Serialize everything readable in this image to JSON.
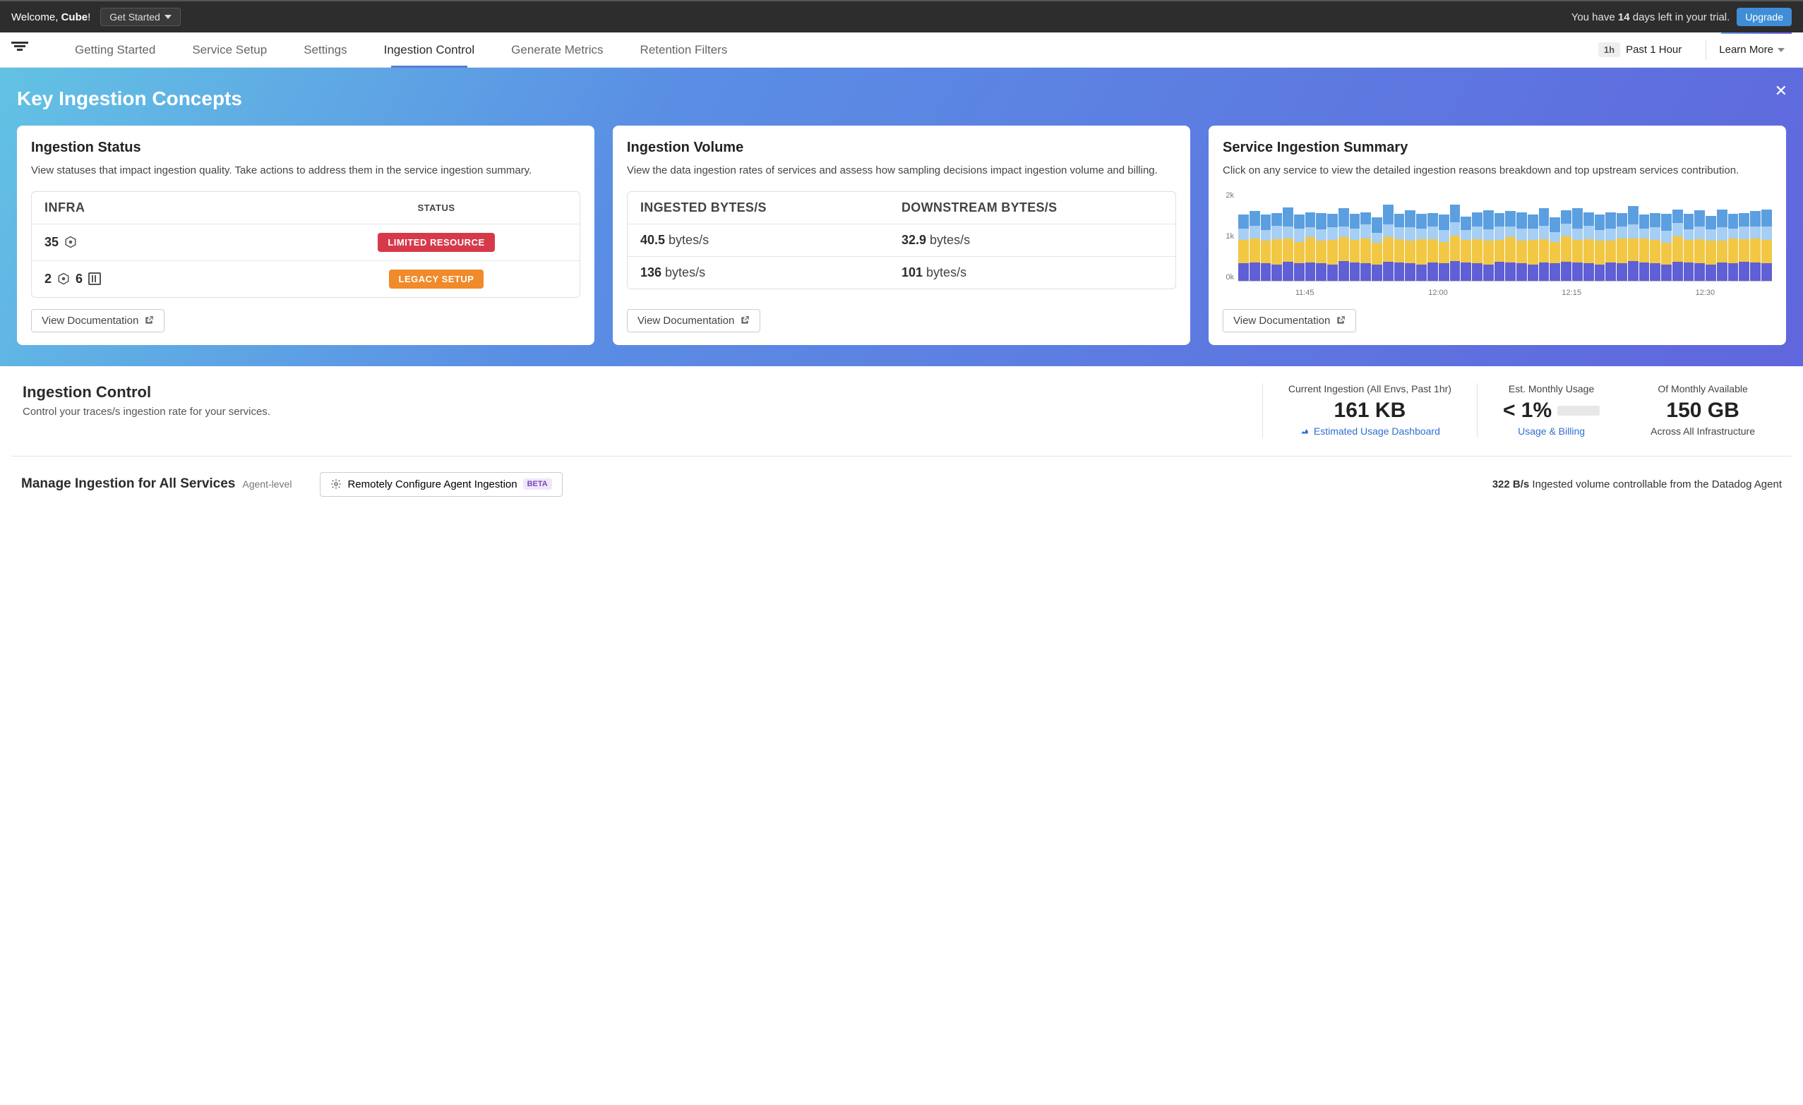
{
  "topbar": {
    "welcome_prefix": "Welcome, ",
    "welcome_name": "Cube",
    "welcome_suffix": "!",
    "get_started": "Get Started",
    "trial_prefix": "You have ",
    "trial_days": "14",
    "trial_suffix": " days left in your trial.",
    "upgrade": "Upgrade"
  },
  "nav": {
    "tabs": [
      "Getting Started",
      "Service Setup",
      "Settings",
      "Ingestion Control",
      "Generate Metrics",
      "Retention Filters"
    ],
    "active_index": 3,
    "time_pill": "1h",
    "time_label": "Past 1 Hour",
    "learn_more": "Learn More"
  },
  "hero": {
    "title": "Key Ingestion Concepts",
    "cards": [
      {
        "title": "Ingestion Status",
        "desc": "View statuses that impact ingestion quality. Take actions to address them in the service ingestion summary.",
        "headers": [
          "INFRA",
          "STATUS"
        ],
        "rows": [
          {
            "col1_a": "35",
            "icon1": "hex",
            "badge": "LIMITED RESOURCE",
            "badge_color": "red"
          },
          {
            "col1_a": "2",
            "icon1": "hex",
            "col1_b": "6",
            "icon2": "bars",
            "badge": "LEGACY SETUP",
            "badge_color": "orange"
          }
        ],
        "doc_label": "View Documentation"
      },
      {
        "title": "Ingestion Volume",
        "desc": "View the data ingestion rates of services and assess how sampling decisions impact ingestion volume and billing.",
        "headers": [
          "INGESTED BYTES/S",
          "DOWNSTREAM BYTES/S"
        ],
        "rows": [
          {
            "c1_val": "40.5",
            "c1_unit": " bytes/s",
            "c2_val": "32.9",
            "c2_unit": " bytes/s"
          },
          {
            "c1_val": "136",
            "c1_unit": " bytes/s",
            "c2_val": "101",
            "c2_unit": " bytes/s"
          }
        ],
        "doc_label": "View Documentation"
      },
      {
        "title": "Service Ingestion Summary",
        "desc": "Click on any service to view the detailed ingestion reasons breakdown and top upstream services contribution.",
        "doc_label": "View Documentation"
      }
    ]
  },
  "summary": {
    "title": "Ingestion Control",
    "subtitle": "Control your traces/s ingestion rate for your services.",
    "stats": [
      {
        "label": "Current Ingestion (All Envs, Past 1hr)",
        "value": "161 KB",
        "link": "Estimated Usage Dashboard",
        "link_icon": "chart"
      },
      {
        "label": "Est. Monthly Usage",
        "value": "< 1%",
        "progress": true,
        "link": "Usage & Billing"
      },
      {
        "label": "Of Monthly Available",
        "value": "150 GB",
        "sub": "Across All Infrastructure"
      }
    ]
  },
  "manage": {
    "title": "Manage Ingestion for All Services",
    "agent_level": "Agent-level",
    "remote_btn": "Remotely Configure Agent Ingestion",
    "beta": "BETA",
    "agent_vol_val": "322 B/s",
    "agent_vol_text": " Ingested volume controllable from the Datadog Agent"
  },
  "chart_data": {
    "type": "stacked_bar",
    "ylabels": [
      "2k",
      "1k",
      "0k"
    ],
    "xlabels": [
      "11:45",
      "12:00",
      "12:15",
      "12:30"
    ],
    "ylim": [
      0,
      2000
    ],
    "series_colors": [
      "#5f5fd6",
      "#f2c744",
      "#a6cff3",
      "#5b9fe0"
    ],
    "bars": [
      [
        380,
        520,
        260,
        300
      ],
      [
        400,
        540,
        280,
        320
      ],
      [
        380,
        500,
        240,
        340
      ],
      [
        360,
        560,
        300,
        280
      ],
      [
        420,
        520,
        260,
        420
      ],
      [
        380,
        480,
        300,
        300
      ],
      [
        400,
        560,
        220,
        340
      ],
      [
        380,
        500,
        260,
        360
      ],
      [
        360,
        540,
        280,
        300
      ],
      [
        440,
        520,
        240,
        400
      ],
      [
        400,
        500,
        260,
        320
      ],
      [
        380,
        560,
        300,
        280
      ],
      [
        360,
        480,
        220,
        340
      ],
      [
        420,
        540,
        280,
        440
      ],
      [
        400,
        520,
        260,
        300
      ],
      [
        380,
        500,
        300,
        380
      ],
      [
        360,
        560,
        240,
        320
      ],
      [
        400,
        520,
        280,
        300
      ],
      [
        380,
        480,
        260,
        340
      ],
      [
        440,
        560,
        300,
        380
      ],
      [
        400,
        500,
        220,
        300
      ],
      [
        380,
        540,
        280,
        320
      ],
      [
        360,
        520,
        260,
        420
      ],
      [
        420,
        480,
        300,
        300
      ],
      [
        400,
        560,
        240,
        340
      ],
      [
        380,
        500,
        280,
        360
      ],
      [
        360,
        540,
        260,
        300
      ],
      [
        400,
        520,
        300,
        380
      ],
      [
        380,
        480,
        220,
        320
      ],
      [
        420,
        560,
        280,
        300
      ],
      [
        400,
        500,
        260,
        440
      ],
      [
        380,
        540,
        300,
        300
      ],
      [
        360,
        520,
        240,
        340
      ],
      [
        400,
        480,
        280,
        360
      ],
      [
        380,
        560,
        260,
        300
      ],
      [
        440,
        500,
        300,
        420
      ],
      [
        400,
        540,
        220,
        300
      ],
      [
        380,
        520,
        280,
        320
      ],
      [
        360,
        480,
        260,
        380
      ],
      [
        420,
        560,
        300,
        300
      ],
      [
        400,
        500,
        240,
        340
      ],
      [
        380,
        540,
        280,
        360
      ],
      [
        360,
        520,
        260,
        300
      ],
      [
        400,
        480,
        300,
        400
      ],
      [
        380,
        560,
        220,
        320
      ],
      [
        420,
        500,
        280,
        300
      ],
      [
        400,
        540,
        260,
        340
      ],
      [
        380,
        520,
        300,
        380
      ]
    ]
  }
}
